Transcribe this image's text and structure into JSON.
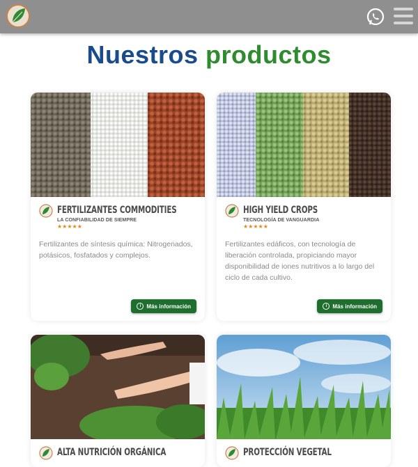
{
  "header": {
    "logo_icon": "leaf-logo-icon",
    "whatsapp_icon": "whatsapp-icon",
    "menu_icon": "hamburger-menu-icon",
    "bar_color": "#8f8f8f"
  },
  "section": {
    "title_part1": "Nuestros",
    "title_part2": "productos",
    "title_color1": "#1a4b8c",
    "title_color2": "#2e8b2e"
  },
  "products": [
    {
      "name": "FERTILIZANTES COMMODITIES",
      "tagline": "LA CONFIABILIDAD DE SIEMPRE",
      "rating": "★★★★★",
      "description": "Fertilizantes de síntesis química: Nitrogenados, potásicos, fosfatados y complejos.",
      "button_label": "Más información"
    },
    {
      "name": "HIGH YIELD CROPS",
      "tagline": "TECNOLOGÍA DE VANGUARDIA",
      "rating": "★★★★★",
      "description": "Fertilizantes edáficos, con tecnología de liberación controlada, propiciando mayor disponibilidad de iones nutritivos a lo largo del ciclo de cada cultivo.",
      "button_label": "Más información"
    },
    {
      "name": "ALTA NUTRICIÓN ORGÁNICA"
    },
    {
      "name": "PROTECCIÓN VEGETAL"
    }
  ],
  "colors": {
    "button": "#1e6e2e",
    "stars": "#e08a1a"
  }
}
